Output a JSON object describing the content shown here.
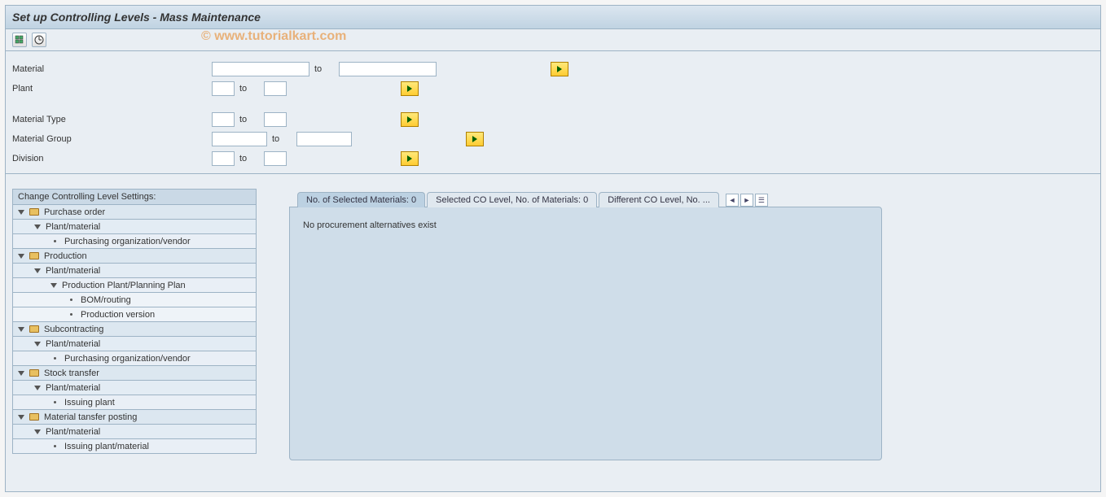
{
  "title": "Set up Controlling Levels - Mass Maintenance",
  "watermark": "© www.tutorialkart.com",
  "form": {
    "to_label": "to",
    "rows": [
      {
        "label": "Material",
        "from": "",
        "to_val": "",
        "size": "lg"
      },
      {
        "label": "Plant",
        "from": "",
        "to_val": "",
        "size": "sm"
      }
    ],
    "rows2": [
      {
        "label": "Material Type",
        "from": "",
        "to_val": "",
        "size": "sm"
      },
      {
        "label": "Material Group",
        "from": "",
        "to_val": "",
        "size": "md"
      },
      {
        "label": "Division",
        "from": "",
        "to_val": "",
        "size": "sm"
      }
    ]
  },
  "tree": {
    "header": "Change Controlling Level Settings:",
    "nodes": [
      {
        "level": 1,
        "type": "folder",
        "label": "Purchase order"
      },
      {
        "level": 2,
        "type": "tri",
        "label": "Plant/material"
      },
      {
        "level": 3,
        "type": "dot",
        "label": "Purchasing organization/vendor"
      },
      {
        "level": 1,
        "type": "folder",
        "label": "Production"
      },
      {
        "level": 2,
        "type": "tri",
        "label": "Plant/material"
      },
      {
        "level": 3,
        "type": "tri",
        "label": "Production Plant/Planning Plan"
      },
      {
        "level": 4,
        "type": "dot",
        "label": "BOM/routing"
      },
      {
        "level": 4,
        "type": "dot",
        "label": "Production version"
      },
      {
        "level": 1,
        "type": "folder",
        "label": "Subcontracting"
      },
      {
        "level": 2,
        "type": "tri",
        "label": "Plant/material"
      },
      {
        "level": 3,
        "type": "dot",
        "label": "Purchasing organization/vendor"
      },
      {
        "level": 1,
        "type": "folder",
        "label": "Stock transfer"
      },
      {
        "level": 2,
        "type": "tri",
        "label": "Plant/material"
      },
      {
        "level": 3,
        "type": "dot",
        "label": "Issuing plant"
      },
      {
        "level": 1,
        "type": "folder",
        "label": "Material tansfer posting"
      },
      {
        "level": 2,
        "type": "tri",
        "label": "Plant/material"
      },
      {
        "level": 3,
        "type": "dot",
        "label": "Issuing plant/material"
      }
    ]
  },
  "tabs": {
    "items": [
      {
        "label": "No. of Selected Materials: 0",
        "active": true
      },
      {
        "label": "Selected CO Level, No. of Materials: 0",
        "active": false
      },
      {
        "label": "Different CO Level, No. ...",
        "active": false
      }
    ],
    "nav": {
      "prev": "◄",
      "next": "►",
      "list": "☰"
    }
  },
  "content_message": "No procurement alternatives exist"
}
